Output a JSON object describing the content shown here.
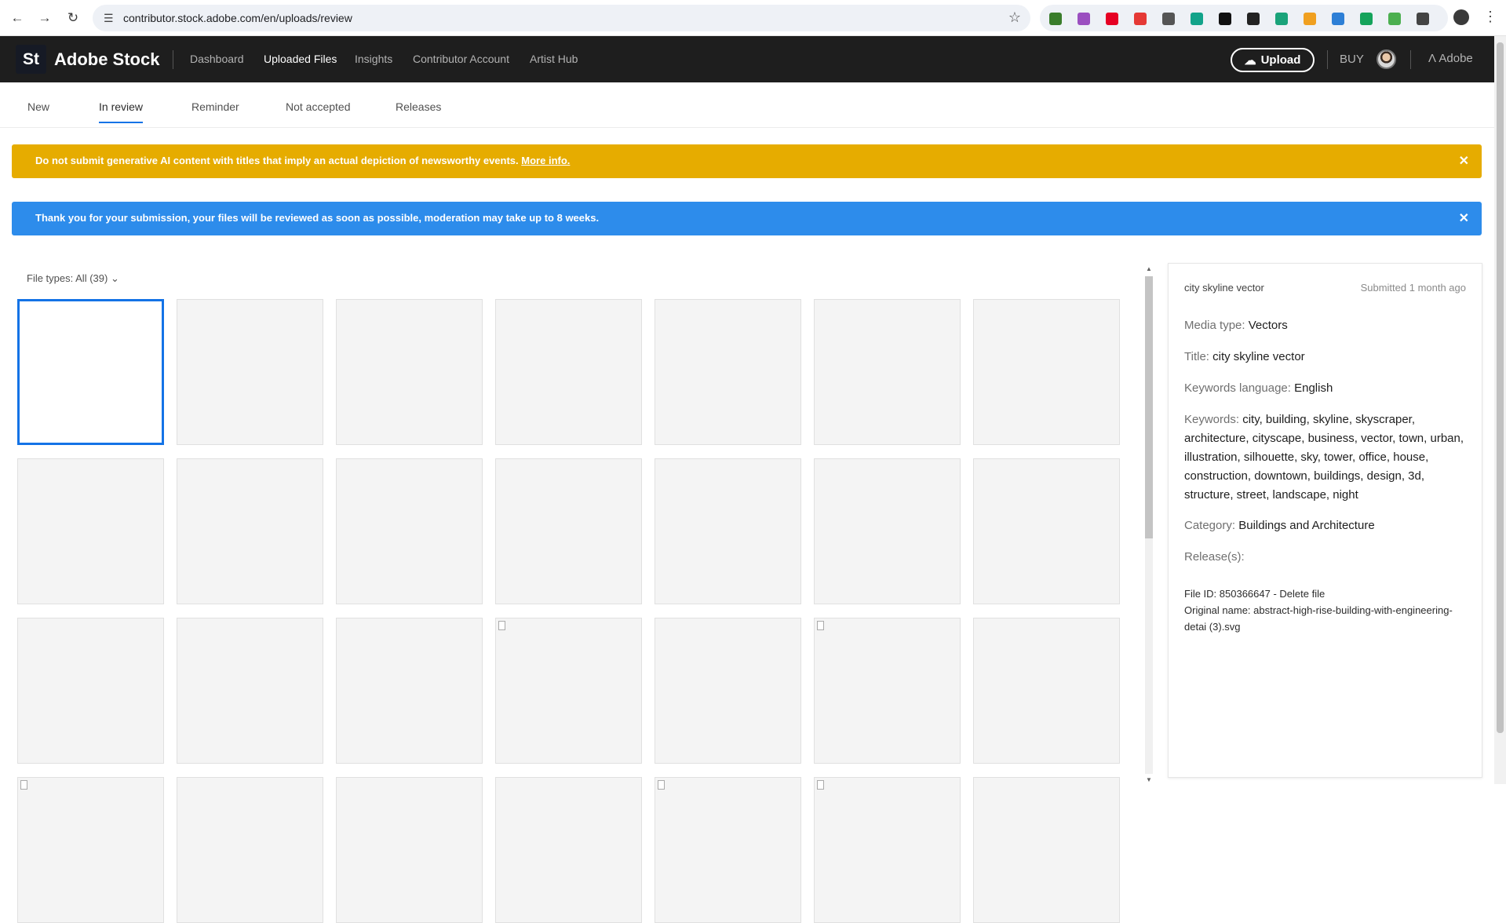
{
  "browser": {
    "url": "contributor.stock.adobe.com/en/uploads/review",
    "extensions": [
      {
        "name": "extension-1-icon",
        "color": "#3a7d2b"
      },
      {
        "name": "extension-2-icon",
        "color": "#9b4fc0"
      },
      {
        "name": "pinterest-icon",
        "color": "#e60023"
      },
      {
        "name": "adblock-icon",
        "color": "#e53935"
      },
      {
        "name": "extension-5-icon",
        "color": "#555555"
      },
      {
        "name": "extension-6-icon",
        "color": "#12a38a"
      },
      {
        "name": "extension-7-icon",
        "color": "#111111"
      },
      {
        "name": "extension-8-icon",
        "color": "#222222"
      },
      {
        "name": "extension-9-icon",
        "color": "#1aa37a"
      },
      {
        "name": "extension-10-icon",
        "color": "#f0a020"
      },
      {
        "name": "extension-11-icon",
        "color": "#2d7fd6"
      },
      {
        "name": "grammarly-icon",
        "color": "#15a35b"
      },
      {
        "name": "extension-13-icon",
        "color": "#4caf50"
      },
      {
        "name": "puzzle-icon",
        "color": "#444444"
      }
    ]
  },
  "header": {
    "logo_tile": "St",
    "brand": "Adobe Stock",
    "nav": [
      "Dashboard",
      "Uploaded Files",
      "Insights",
      "Contributor Account",
      "Artist Hub"
    ],
    "active_nav": "Uploaded Files",
    "upload_label": "Upload",
    "buy_label": "BUY",
    "adobe_label": "Adobe"
  },
  "tabs": {
    "items": [
      "New",
      "In review",
      "Reminder",
      "Not accepted",
      "Releases"
    ],
    "active": "In review",
    "accent": "#1473e6"
  },
  "banners": {
    "warning_text": "Do not submit generative AI content with titles that imply an actual depiction of newsworthy events.",
    "warning_link": "More info.",
    "warning_color": "#e6ac00",
    "info_text": "Thank you for your submission, your files will be reviewed as soon as possible, moderation may take up to 8 weeks.",
    "info_color": "#2d8ceb"
  },
  "grid": {
    "filter_label": "File types: All (39)"
  },
  "detail": {
    "title": "city skyline vector",
    "submitted": "Submitted 1 month ago",
    "media_type_label": "Media type:",
    "media_type": "Vectors",
    "title_label": "Title:",
    "title_value": "city skyline vector",
    "keywords_language_label": "Keywords language:",
    "keywords_language": "English",
    "keywords_label": "Keywords:",
    "keywords": "city, building, skyline, skyscraper, architecture, cityscape, business, vector, town, urban, illustration, silhouette, sky, tower, office, house, construction, downtown, buildings, design, 3d, structure, street, landscape, night",
    "category_label": "Category:",
    "category": "Buildings and Architecture",
    "releases_label": "Release(s):",
    "file_id_line": "File ID: 850366647 - Delete file",
    "original_name_line": "Original name: abstract-high-rise-building-with-engineering-detai (3).svg"
  }
}
